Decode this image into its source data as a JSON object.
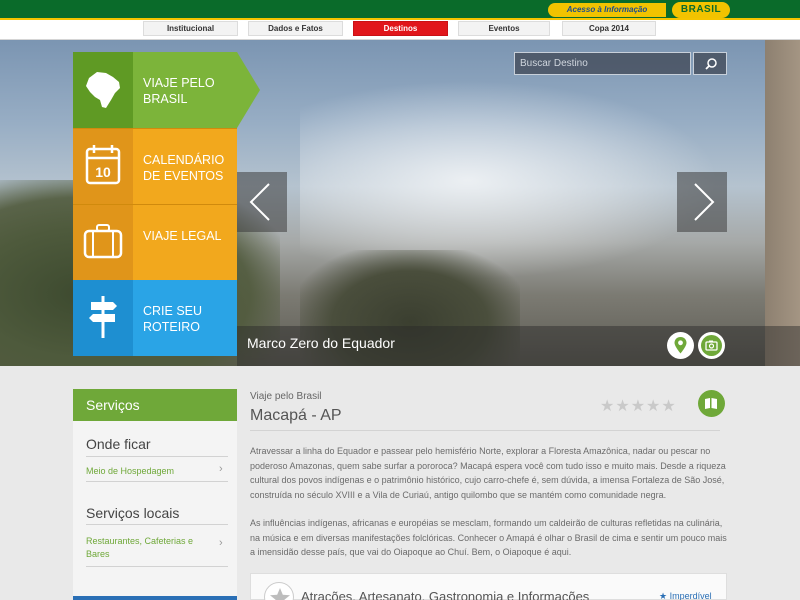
{
  "gov_bar": {
    "access_label": "Acesso à Informação",
    "brand_label": "BRASIL"
  },
  "nav": {
    "items": [
      "Institucional",
      "Dados e Fatos",
      "Destinos",
      "Eventos",
      "Copa 2014"
    ],
    "active_index": 2
  },
  "search": {
    "placeholder": "Buscar Destino"
  },
  "hero": {
    "caption": "Marco Zero do Equador"
  },
  "tiles": [
    {
      "label": "VIAJE PELO BRASIL",
      "icon": "brazil-map-icon",
      "color": "#7cb43a"
    },
    {
      "label": "CALENDÁRIO DE EVENTOS",
      "icon": "calendar-icon",
      "day": "10",
      "color": "#f2a81d"
    },
    {
      "label": "VIAJE LEGAL",
      "icon": "suitcase-icon",
      "color": "#f2a81d"
    },
    {
      "label": "CRIE SEU ROTEIRO",
      "icon": "signpost-icon",
      "color": "#2aa4e6"
    }
  ],
  "sidebar": {
    "header": "Serviços",
    "sections": [
      {
        "title": "Onde ficar",
        "links": [
          "Meio de Hospedagem"
        ]
      },
      {
        "title": "Serviços locais",
        "links": [
          "Restaurantes, Cafeterias e Bares"
        ]
      }
    ]
  },
  "content": {
    "breadcrumb": "Viaje pelo Brasil",
    "title": "Macapá - AP",
    "rating_stars": "★★★★★",
    "paragraphs": [
      "Atravessar a linha do Equador e passear pelo hemisfério Norte, explorar a Floresta Amazônica, nadar ou pescar no poderoso Amazonas, quem sabe surfar a pororoca? Macapá espera você com tudo isso e muito mais. Desde a riqueza cultural dos povos indígenas e o patrimônio histórico, cujo carro-chefe é, sem dúvida, a imensa Fortaleza de São José, construída no século XVIII e a Vila de Curiaú, antigo quilombo que se mantém como comunidade negra.",
      "As influências indígenas, africanas e européias se mesclam, formando um caldeirão de culturas refletidas na culinária, na música e em diversas manifestações folclóricas. Conhecer o Amapá é olhar o Brasil de cima e sentir um pouco mais a imensidão desse país, que vai do Oiapoque ao Chuí. Bem, o Oiapoque é aqui."
    ],
    "card_title": "Atrações, Artesanato, Gastronomia e Informações",
    "card_badge": "★ Imperdível"
  },
  "colors": {
    "gov_green": "#0a6b2a",
    "gov_yellow": "#f2c300",
    "active_red": "#e1161b",
    "services_green": "#6fa839"
  }
}
